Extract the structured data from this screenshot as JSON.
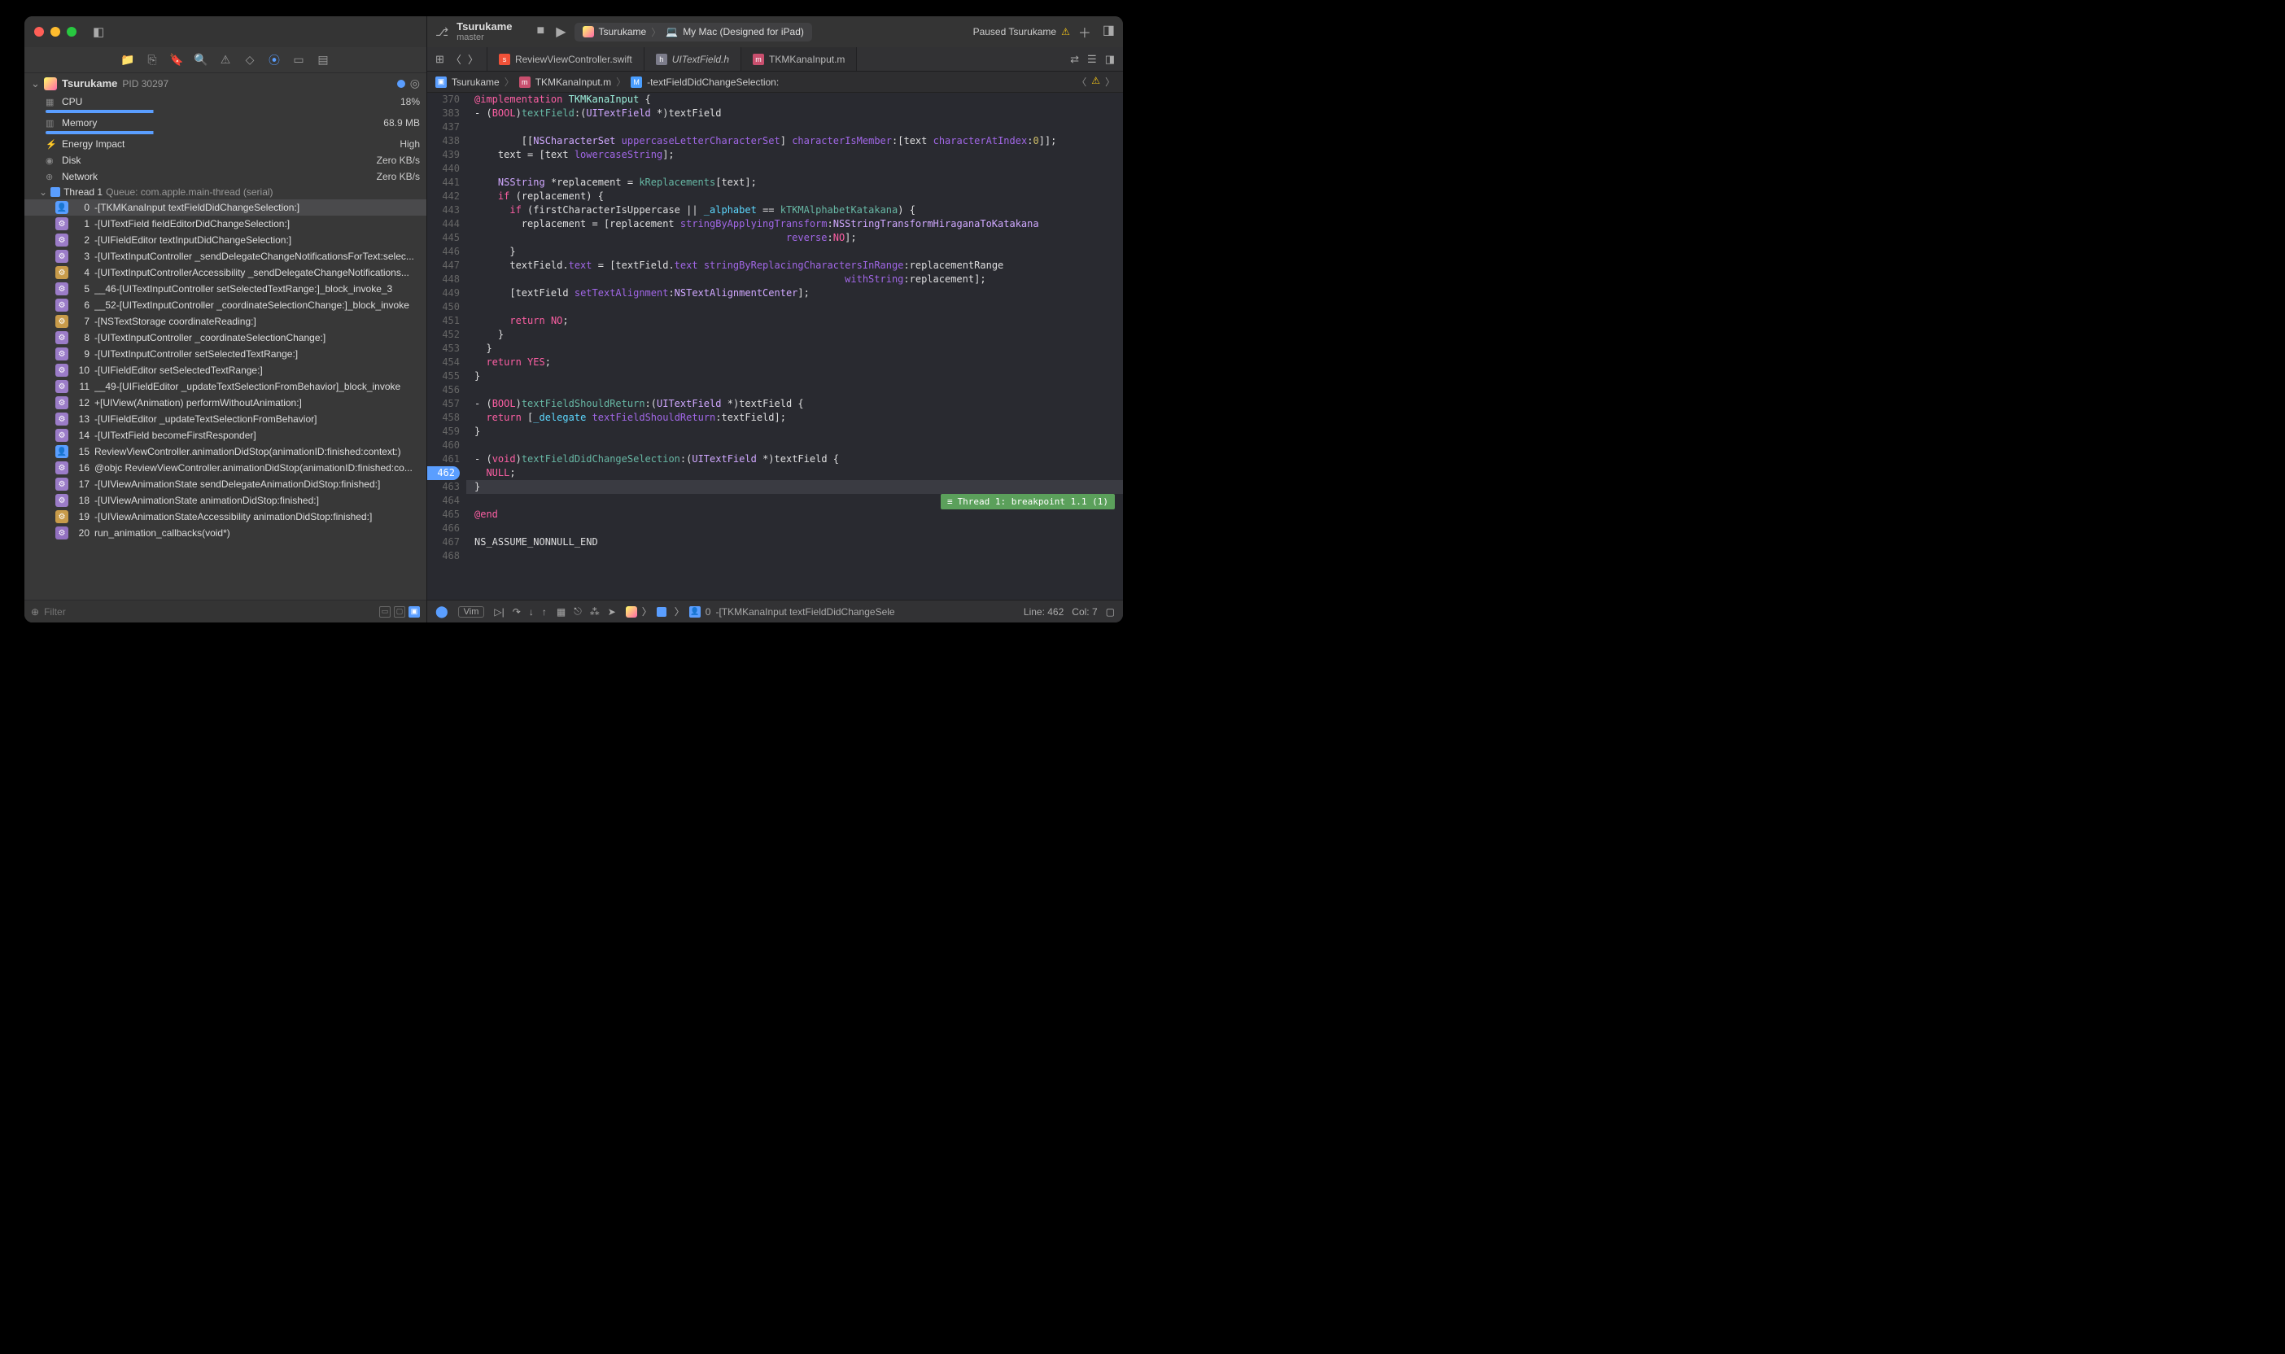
{
  "titlebar": {
    "sidebar_icon": "▥"
  },
  "toolbar_right": {
    "scheme": "Tsurukame",
    "destination": "My Mac (Designed for iPad)",
    "status": "Paused Tsurukame"
  },
  "process": {
    "name": "Tsurukame",
    "pid": "PID 30297"
  },
  "metrics": {
    "cpu": {
      "label": "CPU",
      "value": "18%"
    },
    "memory": {
      "label": "Memory",
      "value": "68.9 MB"
    },
    "energy": {
      "label": "Energy Impact",
      "value": "High"
    },
    "disk": {
      "label": "Disk",
      "value": "Zero KB/s"
    },
    "network": {
      "label": "Network",
      "value": "Zero KB/s"
    }
  },
  "thread": {
    "name": "Thread 1",
    "queue": "Queue: com.apple.main-thread (serial)"
  },
  "frames": [
    {
      "n": "0",
      "t": "-[TKMKanaInput textFieldDidChangeSelection:]",
      "cls": "user",
      "sel": true
    },
    {
      "n": "1",
      "t": "-[UITextField fieldEditorDidChangeSelection:]",
      "cls": "sys"
    },
    {
      "n": "2",
      "t": "-[UIFieldEditor textInputDidChangeSelection:]",
      "cls": "sys"
    },
    {
      "n": "3",
      "t": "-[UITextInputController _sendDelegateChangeNotificationsForText:selec...",
      "cls": "sys"
    },
    {
      "n": "4",
      "t": "-[UITextInputControllerAccessibility _sendDelegateChangeNotifications...",
      "cls": "sys2"
    },
    {
      "n": "5",
      "t": "__46-[UITextInputController setSelectedTextRange:]_block_invoke_3",
      "cls": "sys"
    },
    {
      "n": "6",
      "t": "__52-[UITextInputController _coordinateSelectionChange:]_block_invoke",
      "cls": "sys"
    },
    {
      "n": "7",
      "t": "-[NSTextStorage coordinateReading:]",
      "cls": "sys2"
    },
    {
      "n": "8",
      "t": "-[UITextInputController _coordinateSelectionChange:]",
      "cls": "sys"
    },
    {
      "n": "9",
      "t": "-[UITextInputController setSelectedTextRange:]",
      "cls": "sys"
    },
    {
      "n": "10",
      "t": "-[UIFieldEditor setSelectedTextRange:]",
      "cls": "sys"
    },
    {
      "n": "11",
      "t": "__49-[UIFieldEditor _updateTextSelectionFromBehavior]_block_invoke",
      "cls": "sys"
    },
    {
      "n": "12",
      "t": "+[UIView(Animation) performWithoutAnimation:]",
      "cls": "sys"
    },
    {
      "n": "13",
      "t": "-[UIFieldEditor _updateTextSelectionFromBehavior]",
      "cls": "sys"
    },
    {
      "n": "14",
      "t": "-[UITextField becomeFirstResponder]",
      "cls": "sys"
    },
    {
      "n": "15",
      "t": "ReviewViewController.animationDidStop(animationID:finished:context:)",
      "cls": "user"
    },
    {
      "n": "16",
      "t": "@objc ReviewViewController.animationDidStop(animationID:finished:co...",
      "cls": "sys"
    },
    {
      "n": "17",
      "t": "-[UIViewAnimationState sendDelegateAnimationDidStop:finished:]",
      "cls": "sys"
    },
    {
      "n": "18",
      "t": "-[UIViewAnimationState animationDidStop:finished:]",
      "cls": "sys"
    },
    {
      "n": "19",
      "t": "-[UIViewAnimationStateAccessibility animationDidStop:finished:]",
      "cls": "sys2"
    },
    {
      "n": "20",
      "t": "run_animation_callbacks(void*)",
      "cls": "sys3"
    }
  ],
  "filter": {
    "placeholder": "Filter"
  },
  "tabs": [
    {
      "file": "ReviewViewController.swift",
      "cls": "swift",
      "active": false,
      "italic": false
    },
    {
      "file": "UITextField.h",
      "cls": "h",
      "active": false,
      "italic": true
    },
    {
      "file": "TKMKanaInput.m",
      "cls": "m",
      "active": true,
      "italic": false
    }
  ],
  "crumbs": {
    "project": "Tsurukame",
    "file": "TKMKanaInput.m",
    "method": "-textFieldDidChangeSelection:"
  },
  "code_lines": [
    {
      "n": "370",
      "h": "<span class='kw'>@implementation</span> <span class='type'>TKMKanaInput</span> <span class='plain'>{</span>"
    },
    {
      "n": "383",
      "h": "<span class='plain'>- (</span><span class='kw'>BOOL</span><span class='plain'>)</span><span class='method'>textField</span><span class='plain'>:(</span><span class='type2'>UITextField</span> <span class='plain'>*)textField</span>"
    },
    {
      "n": "437",
      "h": ""
    },
    {
      "n": "438",
      "h": "        <span class='plain'>[[</span><span class='type2'>NSCharacterSet</span> <span class='method2'>uppercaseLetterCharacterSet</span><span class='plain'>]</span> <span class='method2'>characterIsMember</span><span class='plain'>:[text</span> <span class='method2'>characterAtIndex</span><span class='plain'>:</span><span class='num'>0</span><span class='plain'>]];</span>"
    },
    {
      "n": "439",
      "h": "    <span class='plain'>text = [text </span><span class='method2'>lowercaseString</span><span class='plain'>];</span>"
    },
    {
      "n": "440",
      "h": ""
    },
    {
      "n": "441",
      "h": "    <span class='type2'>NSString</span> <span class='plain'>*replacement = </span><span class='ident2'>kReplacements</span><span class='plain'>[text];</span>"
    },
    {
      "n": "442",
      "h": "    <span class='kw'>if</span> <span class='plain'>(replacement) {</span>"
    },
    {
      "n": "443",
      "h": "      <span class='kw'>if</span> <span class='plain'>(firstCharacterIsUppercase || </span><span class='ident'>_alphabet</span> <span class='plain'>==</span> <span class='ident2'>kTKMAlphabetKatakana</span><span class='plain'>) {</span>"
    },
    {
      "n": "444",
      "h": "        <span class='plain'>replacement = [replacement </span><span class='method2'>stringByApplyingTransform</span><span class='plain'>:</span><span class='type2'>NSStringTransformHiraganaToKatakana</span>"
    },
    {
      "n": "445",
      "h": "                                                     <span class='method2'>reverse</span><span class='plain'>:</span><span class='kw'>NO</span><span class='plain'>];</span>"
    },
    {
      "n": "446",
      "h": "      <span class='plain'>}</span>"
    },
    {
      "n": "447",
      "h": "      <span class='plain'>textField.</span><span class='method2'>text</span> <span class='plain'>= [textField.</span><span class='method2'>text</span> <span class='method2'>stringByReplacingCharactersInRange</span><span class='plain'>:replacementRange</span>"
    },
    {
      "n": "448",
      "h": "                                                               <span class='method2'>withString</span><span class='plain'>:replacement];</span>"
    },
    {
      "n": "449",
      "h": "      <span class='plain'>[textField </span><span class='method2'>setTextAlignment</span><span class='plain'>:</span><span class='type2'>NSTextAlignmentCenter</span><span class='plain'>];</span>"
    },
    {
      "n": "450",
      "h": ""
    },
    {
      "n": "451",
      "h": "      <span class='kw'>return</span> <span class='kw'>NO</span><span class='plain'>;</span>"
    },
    {
      "n": "452",
      "h": "    <span class='plain'>}</span>"
    },
    {
      "n": "453",
      "h": "  <span class='plain'>}</span>"
    },
    {
      "n": "454",
      "h": "  <span class='kw'>return</span> <span class='kw'>YES</span><span class='plain'>;</span>"
    },
    {
      "n": "455",
      "h": "<span class='plain'>}</span>"
    },
    {
      "n": "456",
      "h": ""
    },
    {
      "n": "457",
      "h": "<span class='plain'>- (</span><span class='kw'>BOOL</span><span class='plain'>)</span><span class='method'>textFieldShouldReturn</span><span class='plain'>:(</span><span class='type2'>UITextField</span> <span class='plain'>*)textField {</span>"
    },
    {
      "n": "458",
      "h": "  <span class='kw'>return</span> <span class='plain'>[</span><span class='ident'>_delegate</span> <span class='method2'>textFieldShouldReturn</span><span class='plain'>:textField];</span>"
    },
    {
      "n": "459",
      "h": "<span class='plain'>}</span>"
    },
    {
      "n": "460",
      "h": ""
    },
    {
      "n": "461",
      "h": "<span class='plain'>- (</span><span class='kw'>void</span><span class='plain'>)</span><span class='method'>textFieldDidChangeSelection</span><span class='plain'>:(</span><span class='type2'>UITextField</span> <span class='plain'>*)textField {</span>"
    },
    {
      "n": "462",
      "h": "  <span class='kw'>NULL</span><span class='plain'>;</span>",
      "bp": true
    },
    {
      "n": "463",
      "h": "<span class='plain'>}</span>",
      "hl": true,
      "bplabel": "Thread 1: breakpoint 1.1 (1)"
    },
    {
      "n": "464",
      "h": ""
    },
    {
      "n": "465",
      "h": "<span class='kw'>@end</span>"
    },
    {
      "n": "466",
      "h": ""
    },
    {
      "n": "467",
      "h": "<span class='plain'>NS_ASSUME_NONNULL_END</span>"
    },
    {
      "n": "468",
      "h": ""
    }
  ],
  "debug_bar": {
    "vim": "Vim",
    "frame_num": "0",
    "frame_txt": "-[TKMKanaInput textFieldDidChangeSele",
    "line": "Line: 462",
    "col": "Col: 7"
  }
}
